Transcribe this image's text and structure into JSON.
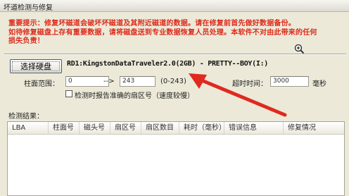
{
  "window": {
    "title": "坏道检测与修复"
  },
  "warning": {
    "line1": "重要提示：修复坏磁道会破坏坏磁道及其附近磁道的数据。请在修复前首先做好数据备份。",
    "line2": "如待修复磁盘上存有重要数据，请将磁盘送到专业数据恢复人员处理。本软件不对由此带来的任何",
    "line3": "损失负责！"
  },
  "disk_select": {
    "button_label": "选择硬盘",
    "disk_info": "RD1:KingstonDataTraveler2.0(2GB) - PRETTY--BOY(I:)"
  },
  "range": {
    "label": "柱面范围：",
    "start": "0",
    "arrow": "-->",
    "end": "243",
    "hint": "(0-243)"
  },
  "timeout": {
    "label": "超时时间：",
    "value": "3000",
    "unit": "毫秒"
  },
  "option": {
    "label": "检测时报告准确的扇区号（速度较慢）",
    "checked": false
  },
  "results": {
    "label": "检测结果：",
    "columns": [
      "LBA",
      "柱面号",
      "磁头号",
      "扇区号",
      "扇区数目",
      "耗时（毫秒）",
      "错误信息",
      "修复情况"
    ]
  },
  "annotation": {
    "arrow_color": "#e0291f"
  },
  "icons": [
    "magnify-plus-icon"
  ]
}
